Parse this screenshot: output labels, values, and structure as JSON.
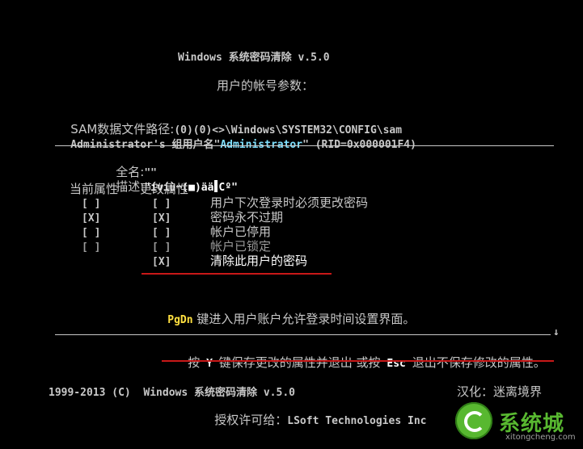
{
  "header": {
    "title": "Windows 系统密码清除 v.5.0",
    "subtitle": "用户的帐号参数："
  },
  "sam": {
    "path_label": "SAM数据文件路径:",
    "path_value": "(0)(0)<>\\Windows\\SYSTEM32\\CONFIG\\sam",
    "account_prefix": "Administrator's 组用户名\"",
    "account_name": "Administrator",
    "account_suffix": "\" (RID=0x000001F4)"
  },
  "user": {
    "fullname_label": "全名:",
    "fullname_value": "\"\"",
    "desc_label": "描述:",
    "desc_value_a": "\"ívíù¬(■)ää",
    "desc_value_b": "Cº\""
  },
  "attrs": {
    "current_header": "当前属性",
    "change_header": "更改属性",
    "rows": [
      {
        "current": "[ ]",
        "change": "[ ]",
        "label": "用户下次登录时必须更改密码",
        "dim": false
      },
      {
        "current": "[X]",
        "change": "[X]",
        "label": "密码永不过期",
        "dim": false
      },
      {
        "current": "[ ]",
        "change": "[ ]",
        "label": "帐户已停用",
        "dim": false
      },
      {
        "current": "[ ]",
        "change": "[ ]",
        "label": "帐户已锁定",
        "dim": true
      },
      {
        "current": "",
        "change": "[X]",
        "label": "清除此用户的密码",
        "dim": false
      }
    ]
  },
  "pgdn": {
    "key": "PgDn",
    "text": "键进入用户账户允许登录时间设置界面。"
  },
  "footer_actions": {
    "press": "按",
    "y_key": "Y",
    "save_text": "键保存更改的属性并退出 或按",
    "esc_key": "Esc",
    "esc_text": "退出不保存修改的属性。",
    "arrow": "↓"
  },
  "credits": {
    "copyright": "1999-2013 (C)  Windows 系统密码清除 v.5.0",
    "license_label": "授权许可给：",
    "license_value": "LSoft Technologies Inc",
    "localized": "汉化：迷离境界"
  },
  "logo": {
    "text": "系统城",
    "url": "xitongcheng.com"
  }
}
